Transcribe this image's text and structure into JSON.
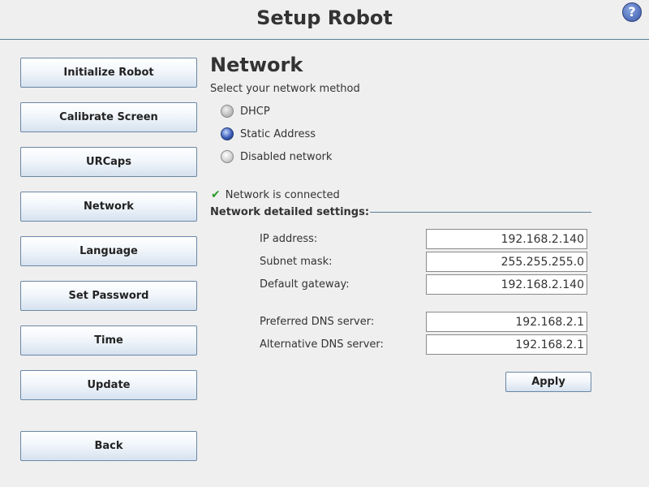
{
  "header": {
    "title": "Setup Robot",
    "help_icon": "help-icon",
    "help_label": "?"
  },
  "sidebar": {
    "items": [
      {
        "label": "Initialize Robot"
      },
      {
        "label": "Calibrate Screen"
      },
      {
        "label": "URCaps"
      },
      {
        "label": "Network"
      },
      {
        "label": "Language"
      },
      {
        "label": "Set Password"
      },
      {
        "label": "Time"
      },
      {
        "label": "Update"
      }
    ],
    "back_label": "Back"
  },
  "network": {
    "title": "Network",
    "method_prompt": "Select your network method",
    "methods": [
      {
        "label": "DHCP",
        "selected": false
      },
      {
        "label": "Static Address",
        "selected": true
      },
      {
        "label": "Disabled network",
        "selected": false
      }
    ],
    "status_icon": "checkmark-icon",
    "status_text": "Network is connected",
    "details_heading": "Network detailed settings:",
    "fields": [
      {
        "label": "IP address:",
        "value": "192.168.2.140"
      },
      {
        "label": "Subnet mask:",
        "value": "255.255.255.0"
      },
      {
        "label": "Default gateway:",
        "value": "192.168.2.140"
      },
      {
        "label": "Preferred DNS server:",
        "value": "192.168.2.1"
      },
      {
        "label": "Alternative DNS server:",
        "value": "192.168.2.1"
      }
    ],
    "apply_label": "Apply"
  },
  "colors": {
    "accent_line": "#5a7f9a",
    "button_border": "#6b87a5",
    "status_check": "#2a9a2a"
  }
}
